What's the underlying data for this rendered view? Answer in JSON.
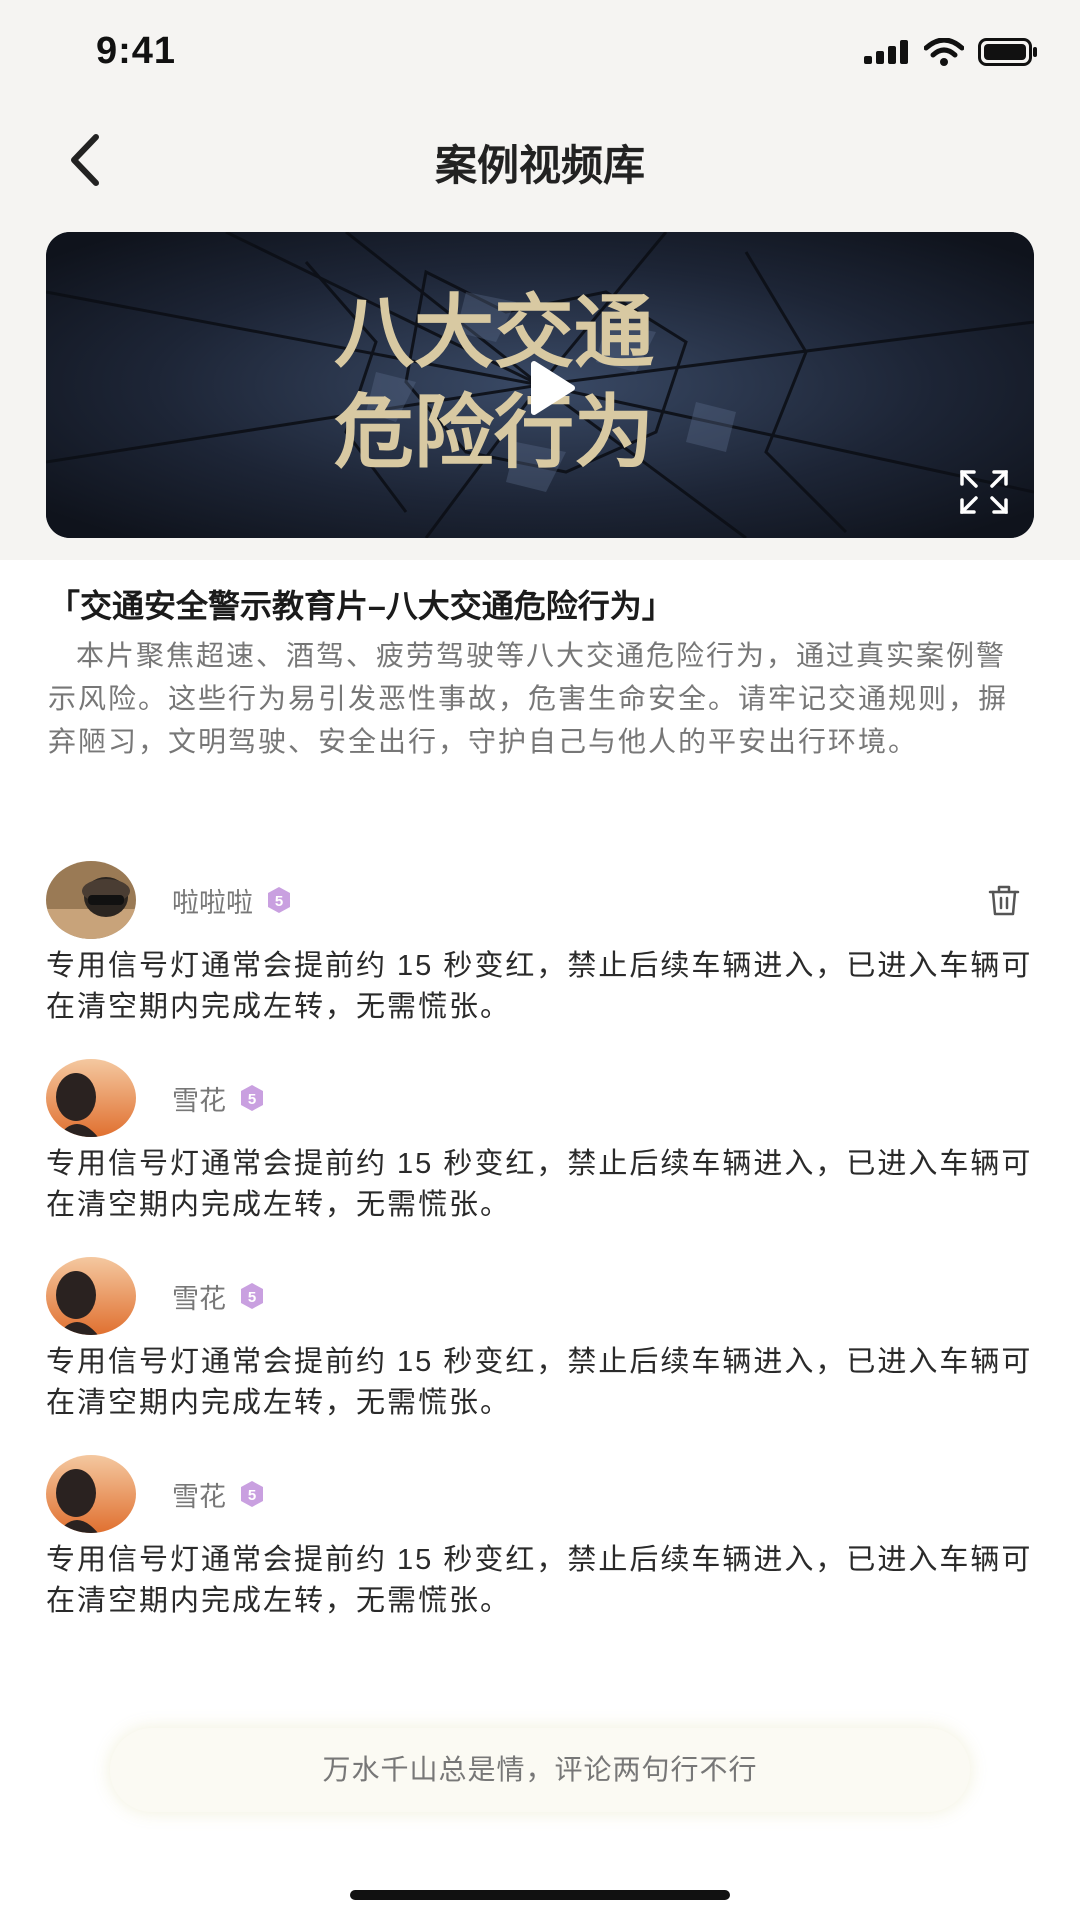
{
  "status_bar": {
    "time": "9:41"
  },
  "nav": {
    "title": "案例视频库"
  },
  "video": {
    "cover_text_line1": "八大交通",
    "cover_text_line2": "危险行为",
    "title": "「交通安全警示教育片–八大交通危险行为」",
    "description": "本片聚焦超速、酒驾、疲劳驾驶等八大交通危险行为，通过真实案例警示风险。这些行为易引发恶性事故，危害生命安全。请牢记交通规则，摒弃陋习，文明驾驶、安全出行，守护自己与他人的平安出行环境。"
  },
  "comments": [
    {
      "username": "啦啦啦",
      "level": "5",
      "text": "专用信号灯通常会提前约 15 秒变红，禁止后续车辆进入，已进入车辆可在清空期内完成左转，无需慌张。"
    },
    {
      "username": "雪花",
      "level": "5",
      "text": "专用信号灯通常会提前约 15 秒变红，禁止后续车辆进入，已进入车辆可在清空期内完成左转，无需慌张。"
    },
    {
      "username": "雪花",
      "level": "5",
      "text": "专用信号灯通常会提前约 15 秒变红，禁止后续车辆进入，已进入车辆可在清空期内完成左转，无需慌张。"
    },
    {
      "username": "雪花",
      "level": "5",
      "text": "专用信号灯通常会提前约 15 秒变红，禁止后续车辆进入，已进入车辆可在清空期内完成左转，无需慌张。"
    }
  ],
  "comment_input": {
    "placeholder": "万水千山总是情，评论两句行不行"
  },
  "colors": {
    "badge": "#c9a0e0",
    "cover_text": "#d8c9a2",
    "video_bg": "#1b2230"
  }
}
